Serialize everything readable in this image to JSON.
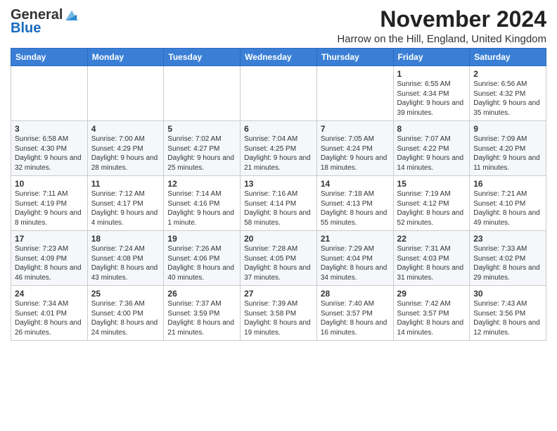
{
  "logo": {
    "general": "General",
    "blue": "Blue"
  },
  "header": {
    "month_title": "November 2024",
    "location": "Harrow on the Hill, England, United Kingdom"
  },
  "days_of_week": [
    "Sunday",
    "Monday",
    "Tuesday",
    "Wednesday",
    "Thursday",
    "Friday",
    "Saturday"
  ],
  "weeks": [
    [
      {
        "day": "",
        "info": ""
      },
      {
        "day": "",
        "info": ""
      },
      {
        "day": "",
        "info": ""
      },
      {
        "day": "",
        "info": ""
      },
      {
        "day": "",
        "info": ""
      },
      {
        "day": "1",
        "info": "Sunrise: 6:55 AM\nSunset: 4:34 PM\nDaylight: 9 hours and 39 minutes."
      },
      {
        "day": "2",
        "info": "Sunrise: 6:56 AM\nSunset: 4:32 PM\nDaylight: 9 hours and 35 minutes."
      }
    ],
    [
      {
        "day": "3",
        "info": "Sunrise: 6:58 AM\nSunset: 4:30 PM\nDaylight: 9 hours and 32 minutes."
      },
      {
        "day": "4",
        "info": "Sunrise: 7:00 AM\nSunset: 4:29 PM\nDaylight: 9 hours and 28 minutes."
      },
      {
        "day": "5",
        "info": "Sunrise: 7:02 AM\nSunset: 4:27 PM\nDaylight: 9 hours and 25 minutes."
      },
      {
        "day": "6",
        "info": "Sunrise: 7:04 AM\nSunset: 4:25 PM\nDaylight: 9 hours and 21 minutes."
      },
      {
        "day": "7",
        "info": "Sunrise: 7:05 AM\nSunset: 4:24 PM\nDaylight: 9 hours and 18 minutes."
      },
      {
        "day": "8",
        "info": "Sunrise: 7:07 AM\nSunset: 4:22 PM\nDaylight: 9 hours and 14 minutes."
      },
      {
        "day": "9",
        "info": "Sunrise: 7:09 AM\nSunset: 4:20 PM\nDaylight: 9 hours and 11 minutes."
      }
    ],
    [
      {
        "day": "10",
        "info": "Sunrise: 7:11 AM\nSunset: 4:19 PM\nDaylight: 9 hours and 8 minutes."
      },
      {
        "day": "11",
        "info": "Sunrise: 7:12 AM\nSunset: 4:17 PM\nDaylight: 9 hours and 4 minutes."
      },
      {
        "day": "12",
        "info": "Sunrise: 7:14 AM\nSunset: 4:16 PM\nDaylight: 9 hours and 1 minute."
      },
      {
        "day": "13",
        "info": "Sunrise: 7:16 AM\nSunset: 4:14 PM\nDaylight: 8 hours and 58 minutes."
      },
      {
        "day": "14",
        "info": "Sunrise: 7:18 AM\nSunset: 4:13 PM\nDaylight: 8 hours and 55 minutes."
      },
      {
        "day": "15",
        "info": "Sunrise: 7:19 AM\nSunset: 4:12 PM\nDaylight: 8 hours and 52 minutes."
      },
      {
        "day": "16",
        "info": "Sunrise: 7:21 AM\nSunset: 4:10 PM\nDaylight: 8 hours and 49 minutes."
      }
    ],
    [
      {
        "day": "17",
        "info": "Sunrise: 7:23 AM\nSunset: 4:09 PM\nDaylight: 8 hours and 46 minutes."
      },
      {
        "day": "18",
        "info": "Sunrise: 7:24 AM\nSunset: 4:08 PM\nDaylight: 8 hours and 43 minutes."
      },
      {
        "day": "19",
        "info": "Sunrise: 7:26 AM\nSunset: 4:06 PM\nDaylight: 8 hours and 40 minutes."
      },
      {
        "day": "20",
        "info": "Sunrise: 7:28 AM\nSunset: 4:05 PM\nDaylight: 8 hours and 37 minutes."
      },
      {
        "day": "21",
        "info": "Sunrise: 7:29 AM\nSunset: 4:04 PM\nDaylight: 8 hours and 34 minutes."
      },
      {
        "day": "22",
        "info": "Sunrise: 7:31 AM\nSunset: 4:03 PM\nDaylight: 8 hours and 31 minutes."
      },
      {
        "day": "23",
        "info": "Sunrise: 7:33 AM\nSunset: 4:02 PM\nDaylight: 8 hours and 29 minutes."
      }
    ],
    [
      {
        "day": "24",
        "info": "Sunrise: 7:34 AM\nSunset: 4:01 PM\nDaylight: 8 hours and 26 minutes."
      },
      {
        "day": "25",
        "info": "Sunrise: 7:36 AM\nSunset: 4:00 PM\nDaylight: 8 hours and 24 minutes."
      },
      {
        "day": "26",
        "info": "Sunrise: 7:37 AM\nSunset: 3:59 PM\nDaylight: 8 hours and 21 minutes."
      },
      {
        "day": "27",
        "info": "Sunrise: 7:39 AM\nSunset: 3:58 PM\nDaylight: 8 hours and 19 minutes."
      },
      {
        "day": "28",
        "info": "Sunrise: 7:40 AM\nSunset: 3:57 PM\nDaylight: 8 hours and 16 minutes."
      },
      {
        "day": "29",
        "info": "Sunrise: 7:42 AM\nSunset: 3:57 PM\nDaylight: 8 hours and 14 minutes."
      },
      {
        "day": "30",
        "info": "Sunrise: 7:43 AM\nSunset: 3:56 PM\nDaylight: 8 hours and 12 minutes."
      }
    ]
  ]
}
